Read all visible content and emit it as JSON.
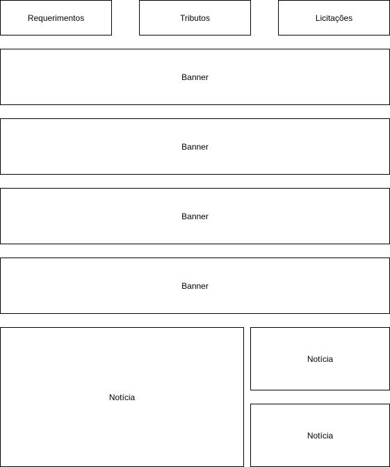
{
  "nav": {
    "items": [
      {
        "label": "Requerimentos"
      },
      {
        "label": "Tributos"
      },
      {
        "label": "Licitações"
      }
    ]
  },
  "banners": [
    {
      "label": "Banner"
    },
    {
      "label": "Banner"
    },
    {
      "label": "Banner"
    },
    {
      "label": "Banner"
    }
  ],
  "news": {
    "main": {
      "label": "Notícia"
    },
    "side": [
      {
        "label": "Notícia"
      },
      {
        "label": "Notícia"
      }
    ]
  }
}
